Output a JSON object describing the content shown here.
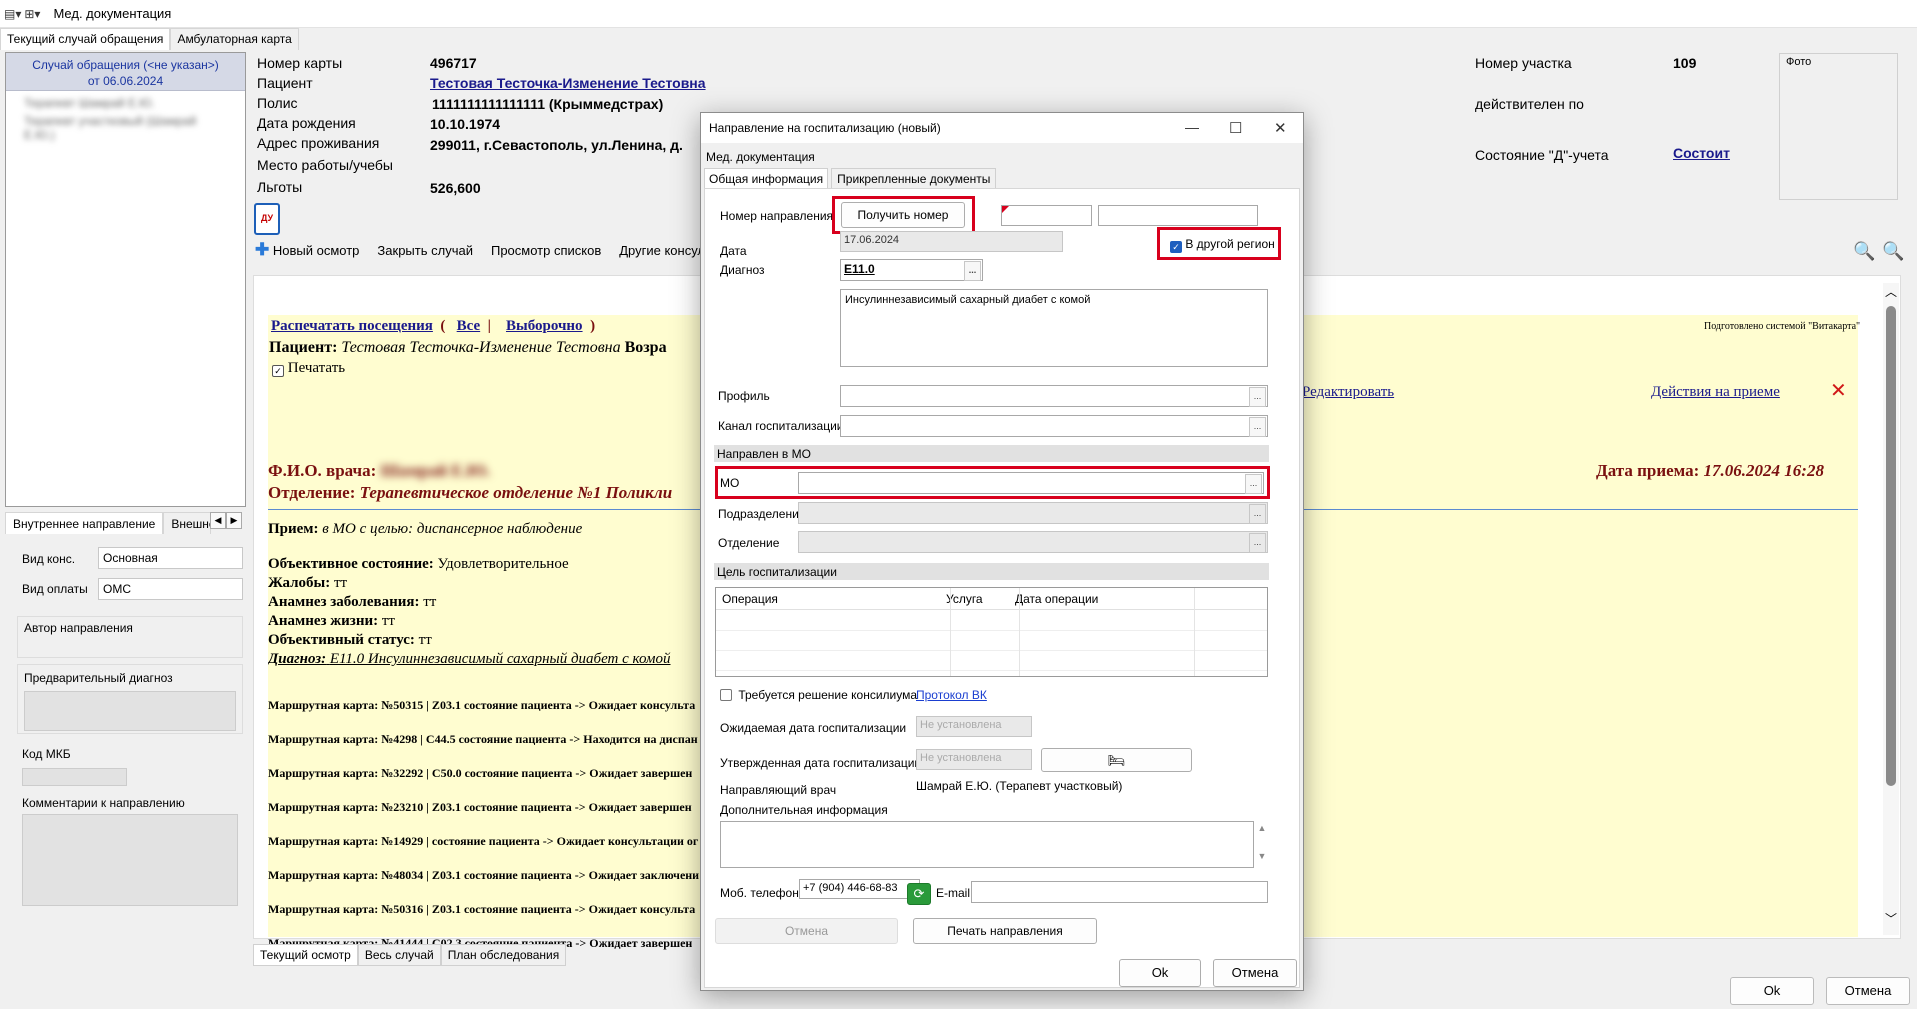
{
  "app": {
    "title": "Мед. документация"
  },
  "top_tabs": [
    "Текущий случай обращения",
    "Амбулаторная карта"
  ],
  "case_list": {
    "selected_line1": "Случай обращения (<не указан>)",
    "selected_line2": "от 06.06.2024",
    "blurred1": "Терапевт Шамрай Е.Ю.",
    "blurred2": "Терапевт участковый (Шамрай Е.Ю.)"
  },
  "left_subtabs": [
    "Внутреннее направление",
    "Внешне"
  ],
  "left_form": {
    "vid_kons_label": "Вид конс.",
    "vid_kons_value": "Основная",
    "vid_oplaty_label": "Вид оплаты",
    "vid_oplaty_value": "ОМС",
    "author_label": "Автор направления",
    "prelim_label": "Предварительный диагноз",
    "mkb_label": "Код МКБ",
    "comment_label": "Комментарии к направлению"
  },
  "patient_info": {
    "card_label": "Номер карты",
    "card_value": "496717",
    "patient_label": "Пациент",
    "patient_value": "Тестовая Тесточка-Изменение Тестовна",
    "policy_label": "Полис",
    "policy_value": "1111111111111111 (Крыммедстрах)",
    "dob_label": "Дата рождения",
    "dob_value": "10.10.1974",
    "address_label": "Адрес проживания",
    "address_value": "299011, г.Севастополь, ул.Ленина, д.",
    "work_label": "Место работы/учебы",
    "benefits_label": "Льготы",
    "benefits_value": "526,600",
    "district_label": "Номер участка",
    "district_value": "109",
    "valid_label": "действителен по",
    "d_status_label": "Состояние \"Д\"-учета",
    "d_status_value": "Состоит",
    "photo_label": "Фото"
  },
  "doc_toolbar": [
    "Новый осмотр",
    "Закрыть случай",
    "Просмотр списков",
    "Другие консуль"
  ],
  "document": {
    "print_visits": "Распечатать посещения",
    "all": "Все",
    "selective": "Выборочно",
    "patient_label": "Пациент:",
    "patient_name": "Тестовая Тесточка-Изменение Тестовна",
    "age_label": "Возра",
    "print_label": "Печатать",
    "prepared_by": "Подготовлено системой \"Витакарта\"",
    "edit_link": "Редактировать",
    "actions_link": "Действия на приеме",
    "doctor_label": "Ф.И.О. врача:",
    "doctor_name": "Шамрай Е.Ю.",
    "department_label": "Отделение:",
    "department_value": "Терапевтическое отделение №1 Поликли",
    "date_label": "Дата приема:",
    "date_value": "17.06.2024 16:28",
    "reception_label": "Прием:",
    "reception_value": "в МО с целью:",
    "reception_goal": "диспансерное наблюдение",
    "objective_label": "Объективное состояние:",
    "objective_value": "Удовлетворительное",
    "complaints_label": "Жалобы:",
    "complaints_value": "тт",
    "disease_label": "Анамнез заболевания:",
    "disease_value": "тт",
    "life_label": "Анамнез жизни:",
    "life_value": "тт",
    "objstatus_label": "Объективный статус:",
    "objstatus_value": "тт",
    "diagnosis_label": "Диагноз:",
    "diagnosis_value": "E11.0 Инсулиннезависимый сахарный диабет с комой",
    "routes": [
      "Маршрутная карта: №50315 | Z03.1 состояние пациента -> Ожидает консульта",
      "Маршрутная карта: №4298 | C44.5 состояние пациента -> Находится на диспан",
      "Маршрутная карта: №32292 | C50.0 состояние пациента -> Ожидает завершен",
      "Маршрутная карта: №23210 | Z03.1 состояние пациента -> Ожидает завершен",
      "Маршрутная карта: №14929 | состояние пациента -> Ожидает консультации ог",
      "Маршрутная карта: №48034 | Z03.1 состояние пациента -> Ожидает заключени",
      "Маршрутная карта: №50316 | Z03.1 состояние пациента -> Ожидает консульта",
      "Маршрутная карта: №41444 | C02.3 состояние пациента -> Ожидает завершен"
    ]
  },
  "bottom_tabs": [
    "Текущий осмотр",
    "Весь случай",
    "План обследования"
  ],
  "main_buttons": {
    "ok": "Ok",
    "cancel": "Отмена"
  },
  "dialog": {
    "title": "Направление на госпитализацию (новый)",
    "menu": "Мед. документация",
    "tabs": [
      "Общая информация",
      "Прикрепленные документы"
    ],
    "number_label": "Номер направления",
    "get_number": "Получить номер",
    "date_label": "Дата",
    "date_value": "17.06.2024",
    "other_region": "В другой регион",
    "diagnosis_label": "Диагноз",
    "diagnosis_code": "E11.0",
    "diagnosis_text": "Инсулиннезависимый сахарный диабет с комой",
    "profile_label": "Профиль",
    "channel_label": "Канал госпитализации",
    "sent_to_header": "Направлен в МО",
    "mo_label": "МО",
    "subdivision_label": "Подразделение",
    "department_label": "Отделение",
    "goal_header": "Цель госпитализации",
    "table_headers": [
      "Операция",
      "Услуга",
      "Дата операции"
    ],
    "council_label": "Требуется решение консилиума",
    "protocol_link": "Протокол ВК",
    "expected_date_label": "Ожидаемая дата госпитализации",
    "expected_date_placeholder": "Не установлена",
    "approved_date_label": "Утвержденная дата госпитализации",
    "approved_date_placeholder": "Не установлена",
    "doctor_label": "Направляющий врач",
    "doctor_value": "Шамрай Е.Ю. (Терапевт участковый)",
    "additional_label": "Дополнительная информация",
    "phone_label": "Моб. телефон",
    "phone_value": "+7 (904) 446-68-83",
    "email_label": "E-mail",
    "cancel_inner": "Отмена",
    "print_btn": "Печать направления",
    "ok": "Ok",
    "cancel": "Отмена"
  },
  "colors": {
    "highlight": "#d8001d",
    "link": "#1a1a8c",
    "doc_heading": "#7a1010",
    "doc_bg": "#fffdd0"
  }
}
